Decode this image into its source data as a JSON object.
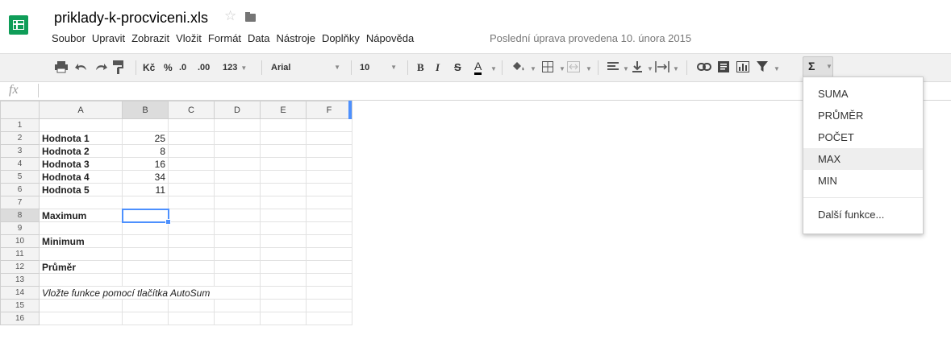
{
  "header": {
    "doc_title": "priklady-k-procviceni.xls",
    "star_icon": "☆",
    "last_edit": "Poslední úprava provedena 10. února 2015"
  },
  "menu": [
    "Soubor",
    "Upravit",
    "Zobrazit",
    "Vložit",
    "Formát",
    "Data",
    "Nástroje",
    "Doplňky",
    "Nápověda"
  ],
  "toolbar": {
    "currency": "Kč",
    "percent": "%",
    "dec_less": ".0",
    "dec_more": ".00",
    "format_more": "123",
    "font": "Arial",
    "font_size": "10",
    "bold": "B",
    "italic": "I",
    "strike": "S",
    "text_color": "A",
    "sigma": "Σ"
  },
  "formula_bar": {
    "fx_label": "fx",
    "value": ""
  },
  "sheet": {
    "columns": [
      "A",
      "B",
      "C",
      "D",
      "E",
      "F"
    ],
    "rows": [
      {
        "n": "1",
        "a": "",
        "b": ""
      },
      {
        "n": "2",
        "a": "Hodnota 1",
        "b": "25"
      },
      {
        "n": "3",
        "a": "Hodnota 2",
        "b": "8"
      },
      {
        "n": "4",
        "a": "Hodnota 3",
        "b": "16"
      },
      {
        "n": "5",
        "a": "Hodnota 4",
        "b": "34"
      },
      {
        "n": "6",
        "a": "Hodnota 5",
        "b": "11"
      },
      {
        "n": "7",
        "a": "",
        "b": ""
      },
      {
        "n": "8",
        "a": "Maximum",
        "b": ""
      },
      {
        "n": "9",
        "a": "",
        "b": ""
      },
      {
        "n": "10",
        "a": "Minimum",
        "b": ""
      },
      {
        "n": "11",
        "a": "",
        "b": ""
      },
      {
        "n": "12",
        "a": "Průměr",
        "b": ""
      },
      {
        "n": "13",
        "a": "",
        "b": ""
      },
      {
        "n": "14",
        "a": "Vložte funkce pomocí tlačítka AutoSum",
        "b": ""
      },
      {
        "n": "15",
        "a": "",
        "b": ""
      },
      {
        "n": "16",
        "a": "",
        "b": ""
      }
    ],
    "active_cell": "B8"
  },
  "autosum_menu": {
    "items": [
      "SUMA",
      "PRŮMĚR",
      "POČET",
      "MAX",
      "MIN"
    ],
    "highlighted": "MAX",
    "more": "Další funkce..."
  },
  "colors": {
    "accent": "#4d90fe",
    "sheets_green": "#0f9d58"
  }
}
